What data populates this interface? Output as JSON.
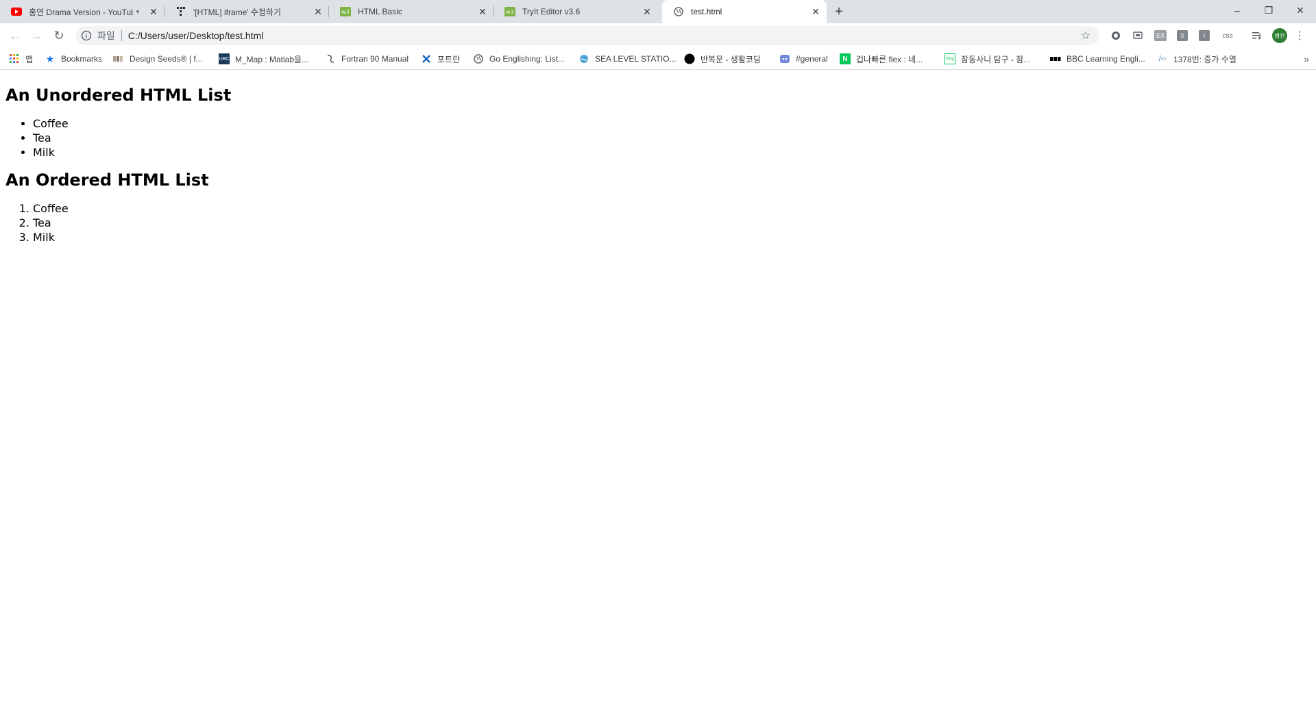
{
  "browser": {
    "tabs": [
      {
        "title": "홍연 Drama Version - YouTube",
        "icon": "youtube-icon",
        "muted": true,
        "active": false
      },
      {
        "title": "'[HTML] iframe' 수정하기",
        "icon": "velog-icon",
        "muted": false,
        "active": false
      },
      {
        "title": "HTML Basic",
        "icon": "w3schools-icon",
        "muted": false,
        "active": false
      },
      {
        "title": "TryIt Editor v3.6",
        "icon": "w3schools-icon",
        "muted": false,
        "active": false
      },
      {
        "title": "test.html",
        "icon": "globe-icon",
        "muted": false,
        "active": true
      }
    ],
    "new_tab_label": "+",
    "window_controls": {
      "minimize": "–",
      "restore": "❐",
      "close": "✕"
    }
  },
  "toolbar": {
    "back": "←",
    "forward": "→",
    "reload": "↻",
    "scheme_label": "파일",
    "url": "C:/Users/user/Desktop/test.html",
    "star": "☆",
    "extensions": [
      {
        "icon": "extension-circle-icon",
        "text": ""
      },
      {
        "icon": "extension-screen-icon",
        "text": ""
      },
      {
        "icon": "extension-ex-icon",
        "text": "EX"
      },
      {
        "icon": "extension-s-icon",
        "text": "S"
      },
      {
        "icon": "extension-i-icon",
        "text": "I"
      },
      {
        "icon": "extension-css-icon",
        "text": "css"
      },
      {
        "icon": "reading-list-icon",
        "text": ""
      }
    ],
    "profile_text": "범진",
    "menu": "⋮"
  },
  "bookmarks": {
    "items": [
      {
        "label": "앱",
        "icon": "apps-grid-icon"
      },
      {
        "label": "Bookmarks",
        "icon": "star-icon"
      },
      {
        "label": "Design Seeds® | f...",
        "icon": "design-seeds-icon"
      },
      {
        "label": "M_Map : Matlab을...",
        "icon": "mmap-icon"
      },
      {
        "label": "Fortran 90 Manual",
        "icon": "fortran-icon"
      },
      {
        "label": "포트란",
        "icon": "fortran-cross-icon"
      },
      {
        "label": "Go Englishing: List...",
        "icon": "globe-icon"
      },
      {
        "label": "SEA LEVEL STATIO...",
        "icon": "sea-level-icon"
      },
      {
        "label": "반복문 - 생활코딩",
        "icon": "black-circle-icon"
      },
      {
        "label": "#general",
        "icon": "discord-icon"
      },
      {
        "label": "겁나빠른 flex : 네...",
        "icon": "naver-icon"
      },
      {
        "label": "잠동사니 탐구 - 잠...",
        "icon": "blog-icon"
      },
      {
        "label": "BBC Learning Engli...",
        "icon": "bbc-icon"
      },
      {
        "label": "1378번: 증가 수열",
        "icon": "code-icon"
      }
    ],
    "more": "»"
  },
  "page": {
    "unordered_heading": "An Unordered HTML List",
    "unordered_items": [
      "Coffee",
      "Tea",
      "Milk"
    ],
    "ordered_heading": "An Ordered HTML List",
    "ordered_items": [
      "Coffee",
      "Tea",
      "Milk"
    ]
  },
  "colors": {
    "tabstrip": "#dee1e6",
    "youtube_red": "#ff0000",
    "w3_green": "#7cb342",
    "profile_green": "#2e7d32"
  }
}
